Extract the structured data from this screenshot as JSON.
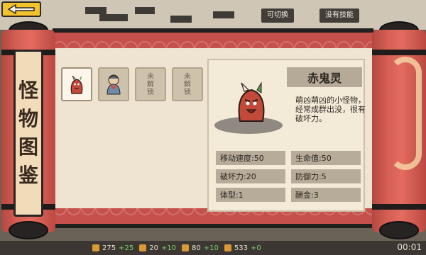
{
  "header": {
    "tab_buttons": [
      "可切换",
      "没有技能"
    ]
  },
  "back_button": {
    "icon": "back-arrow-icon"
  },
  "title": "怪物图鉴",
  "cards": [
    {
      "state": "selected",
      "name": "赤鬼灵"
    },
    {
      "state": "unlocked"
    },
    {
      "state": "locked",
      "label": "未解锁"
    },
    {
      "state": "locked",
      "label": "未解锁"
    }
  ],
  "detail": {
    "name": "赤鬼灵",
    "description": "萌凶萌凶的小怪物，经常成群出没，很有破坏力。",
    "stats": [
      {
        "label": "移动速度:50"
      },
      {
        "label": "生命值:50"
      },
      {
        "label": "破坏力:20"
      },
      {
        "label": "防御力:5"
      },
      {
        "label": "体型:1"
      },
      {
        "label": "酬金:3"
      }
    ]
  },
  "bottom_bar": {
    "items": [
      {
        "value": "275",
        "plus": "+25"
      },
      {
        "value": "20",
        "plus": "+10"
      },
      {
        "value": "80",
        "plus": "+10"
      },
      {
        "value": "533",
        "plus": "+0"
      }
    ],
    "timer": "00:01"
  },
  "colors": {
    "scroll_red": "#c6504b",
    "paper": "#efe4d1",
    "accent_yellow": "#f2c32b"
  }
}
